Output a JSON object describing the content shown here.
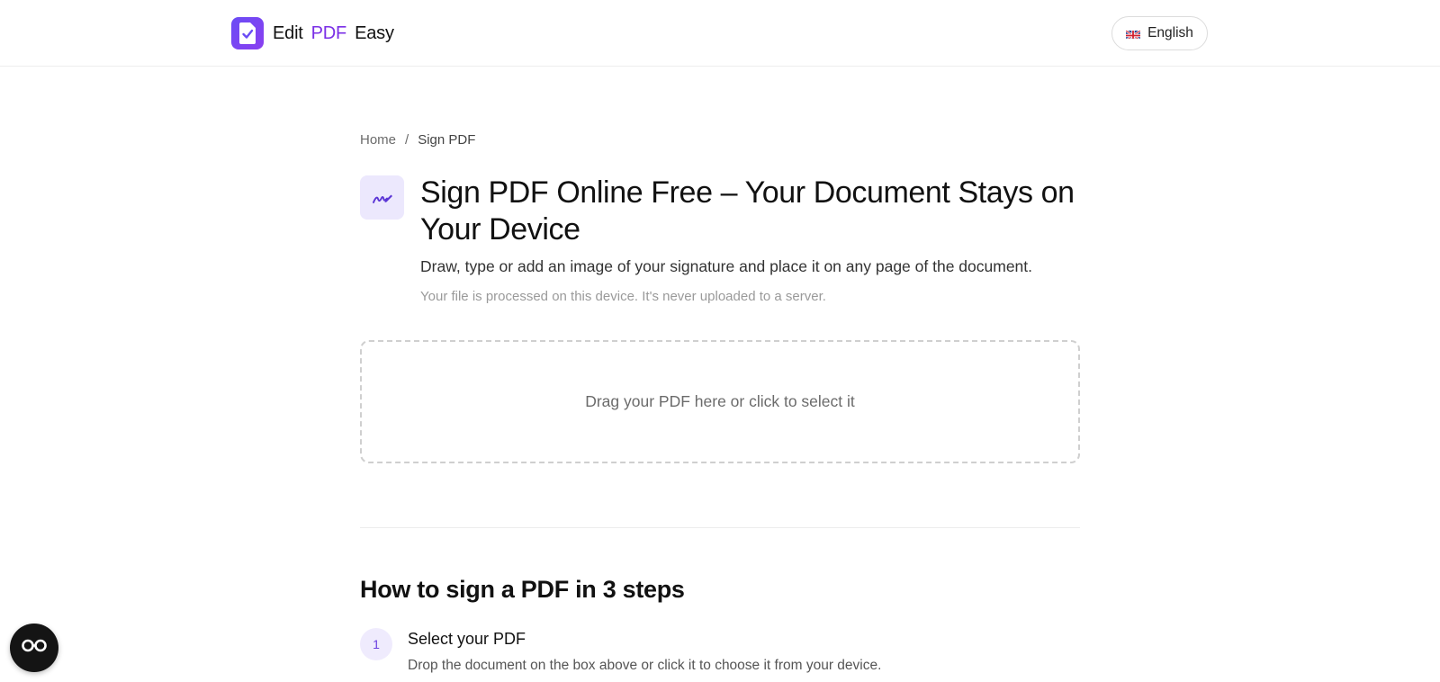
{
  "header": {
    "logo": {
      "icon": "document-check-icon",
      "text_before": "Edit",
      "text_accent": "PDF",
      "text_after": "Easy",
      "accent_color": "#7a2fe6"
    },
    "language": {
      "flag_icon": "uk-flag-icon",
      "label": "English"
    }
  },
  "breadcrumb": {
    "home": "Home",
    "separator": "/",
    "current": "Sign PDF"
  },
  "tool": {
    "icon": "signature-icon",
    "title": "Sign PDF Online Free – Your Document Stays on Your Device",
    "subtitle": "Draw, type or add an image of your signature and place it on any page of the document.",
    "privacy_note": "Your file is processed on this device. It's never uploaded to a server."
  },
  "dropzone": {
    "text": "Drag your PDF here or click to select it"
  },
  "steps": {
    "title": "How to sign a PDF in 3 steps",
    "items": [
      {
        "number": "1",
        "title": "Select your PDF",
        "description": "Drop the document on the box above or click it to choose it from your device."
      }
    ]
  },
  "accessibility": {
    "icon": "accessibility-glasses-icon"
  }
}
